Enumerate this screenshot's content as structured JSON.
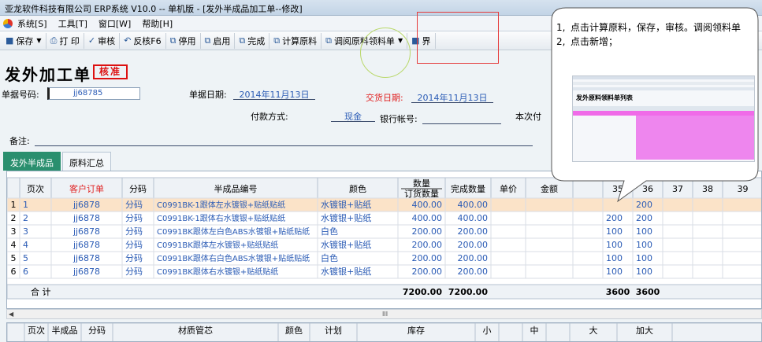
{
  "window": {
    "title": "亚龙软件科技有限公司 ERP系统 V10.0 -- 单机版 - [发外半成品加工单--修改]"
  },
  "menu": {
    "items": [
      "系统[S]",
      "工具[T]",
      "窗口[W]",
      "帮助[H]"
    ]
  },
  "toolbar": {
    "items": [
      {
        "icon": "save-icon",
        "glyph": "■",
        "label": "保存",
        "caret": true
      },
      {
        "icon": "print-icon",
        "glyph": "⎙",
        "label": "打 印",
        "caret": false
      },
      {
        "icon": "audit-icon",
        "glyph": "✓",
        "label": "审核",
        "caret": false
      },
      {
        "icon": "unaudit-icon",
        "glyph": "↶",
        "label": "反核F6",
        "caret": false
      },
      {
        "icon": "disable-icon",
        "glyph": "⧉",
        "label": "停用",
        "caret": false
      },
      {
        "icon": "enable-icon",
        "glyph": "⧉",
        "label": "启用",
        "caret": false
      },
      {
        "icon": "complete-icon",
        "glyph": "⧉",
        "label": "完成",
        "caret": false
      },
      {
        "icon": "calc-icon",
        "glyph": "⧉",
        "label": "计算原料",
        "caret": false
      },
      {
        "icon": "fetch-material-icon",
        "glyph": "⧉",
        "label": "调阅原料领料单",
        "caret": true
      },
      {
        "icon": "interface-icon",
        "glyph": "■",
        "label": "界",
        "caret": false
      }
    ]
  },
  "form": {
    "title": "发外加工单",
    "stamp": "核准",
    "doc_no_label": "单据号码:",
    "doc_no_value": "jj68785",
    "doc_date_label": "单据日期:",
    "doc_date_value": "2014年11月13日",
    "delivery_label": "交货日期:",
    "delivery_value": "2014年11月13日",
    "payment_label": "付款方式:",
    "payment_value": "现金",
    "bank_label": "银行帐号:",
    "bank_value": "",
    "current_label": "本次付",
    "remark_label": "备注:"
  },
  "tabs": [
    {
      "label": "发外半成品",
      "active": true
    },
    {
      "label": "原料汇总",
      "active": false
    }
  ],
  "grid": {
    "headers": {
      "page": "页次",
      "order": "客户订单",
      "code": "分码",
      "part": "半成品编号",
      "color": "颜色",
      "qty_top": "数量",
      "qty_bottom": "订货数量",
      "done": "完成数量",
      "price": "单价",
      "amount": "金额",
      "s35": "35",
      "s36": "36",
      "s37": "37",
      "s38": "38",
      "s39": "39"
    },
    "rows": [
      {
        "n": "1",
        "page": "1",
        "order": "jj6878",
        "code": "分码",
        "part": "C0991BK-1跟体左水镀银+贴纸贴纸",
        "color": "水镀银+贴纸",
        "qty": "400.00",
        "done": "400.00",
        "s35": "",
        "s36": "200"
      },
      {
        "n": "2",
        "page": "2",
        "order": "jj6878",
        "code": "分码",
        "part": "C0991BK-1跟体右水镀银+贴纸贴纸",
        "color": "水镀银+贴纸",
        "qty": "400.00",
        "done": "400.00",
        "s35": "200",
        "s36": "200"
      },
      {
        "n": "3",
        "page": "3",
        "order": "jj6878",
        "code": "分码",
        "part": "C0991BK跟体左白色ABS水镀银+贴纸贴纸",
        "color": "白色",
        "qty": "200.00",
        "done": "200.00",
        "s35": "100",
        "s36": "100"
      },
      {
        "n": "4",
        "page": "4",
        "order": "jj6878",
        "code": "分码",
        "part": "C0991BK跟体左水镀银+贴纸贴纸",
        "color": "水镀银+贴纸",
        "qty": "200.00",
        "done": "200.00",
        "s35": "100",
        "s36": "100"
      },
      {
        "n": "5",
        "page": "5",
        "order": "jj6878",
        "code": "分码",
        "part": "C0991BK跟体右白色ABS水镀银+贴纸贴纸",
        "color": "白色",
        "qty": "200.00",
        "done": "200.00",
        "s35": "100",
        "s36": "100"
      },
      {
        "n": "6",
        "page": "6",
        "order": "jj6878",
        "code": "分码",
        "part": "C0991BK跟体右水镀银+贴纸贴纸",
        "color": "水镀银+贴纸",
        "qty": "200.00",
        "done": "200.00",
        "s35": "100",
        "s36": "100"
      }
    ],
    "totals": {
      "label": "合 计",
      "qty": "7200.00",
      "done": "7200.00",
      "s35": "3600",
      "s36": "3600"
    },
    "scroll_grip": "III"
  },
  "grid2": {
    "headers": {
      "page": "页次",
      "semi": "半成品",
      "code": "分码",
      "material": "材质管芯",
      "color": "颜色",
      "plan": "计划",
      "stock": "库存",
      "small": "小",
      "mid": "中",
      "big": "大",
      "xbig": "加大"
    }
  },
  "callout": {
    "steps": [
      {
        "num": "1,",
        "text": "点击计算原料，保存，审核。调阅领料单"
      },
      {
        "num": "2,",
        "text": "点击新增；"
      }
    ],
    "thumb_title": "发外原料领料单列表"
  }
}
